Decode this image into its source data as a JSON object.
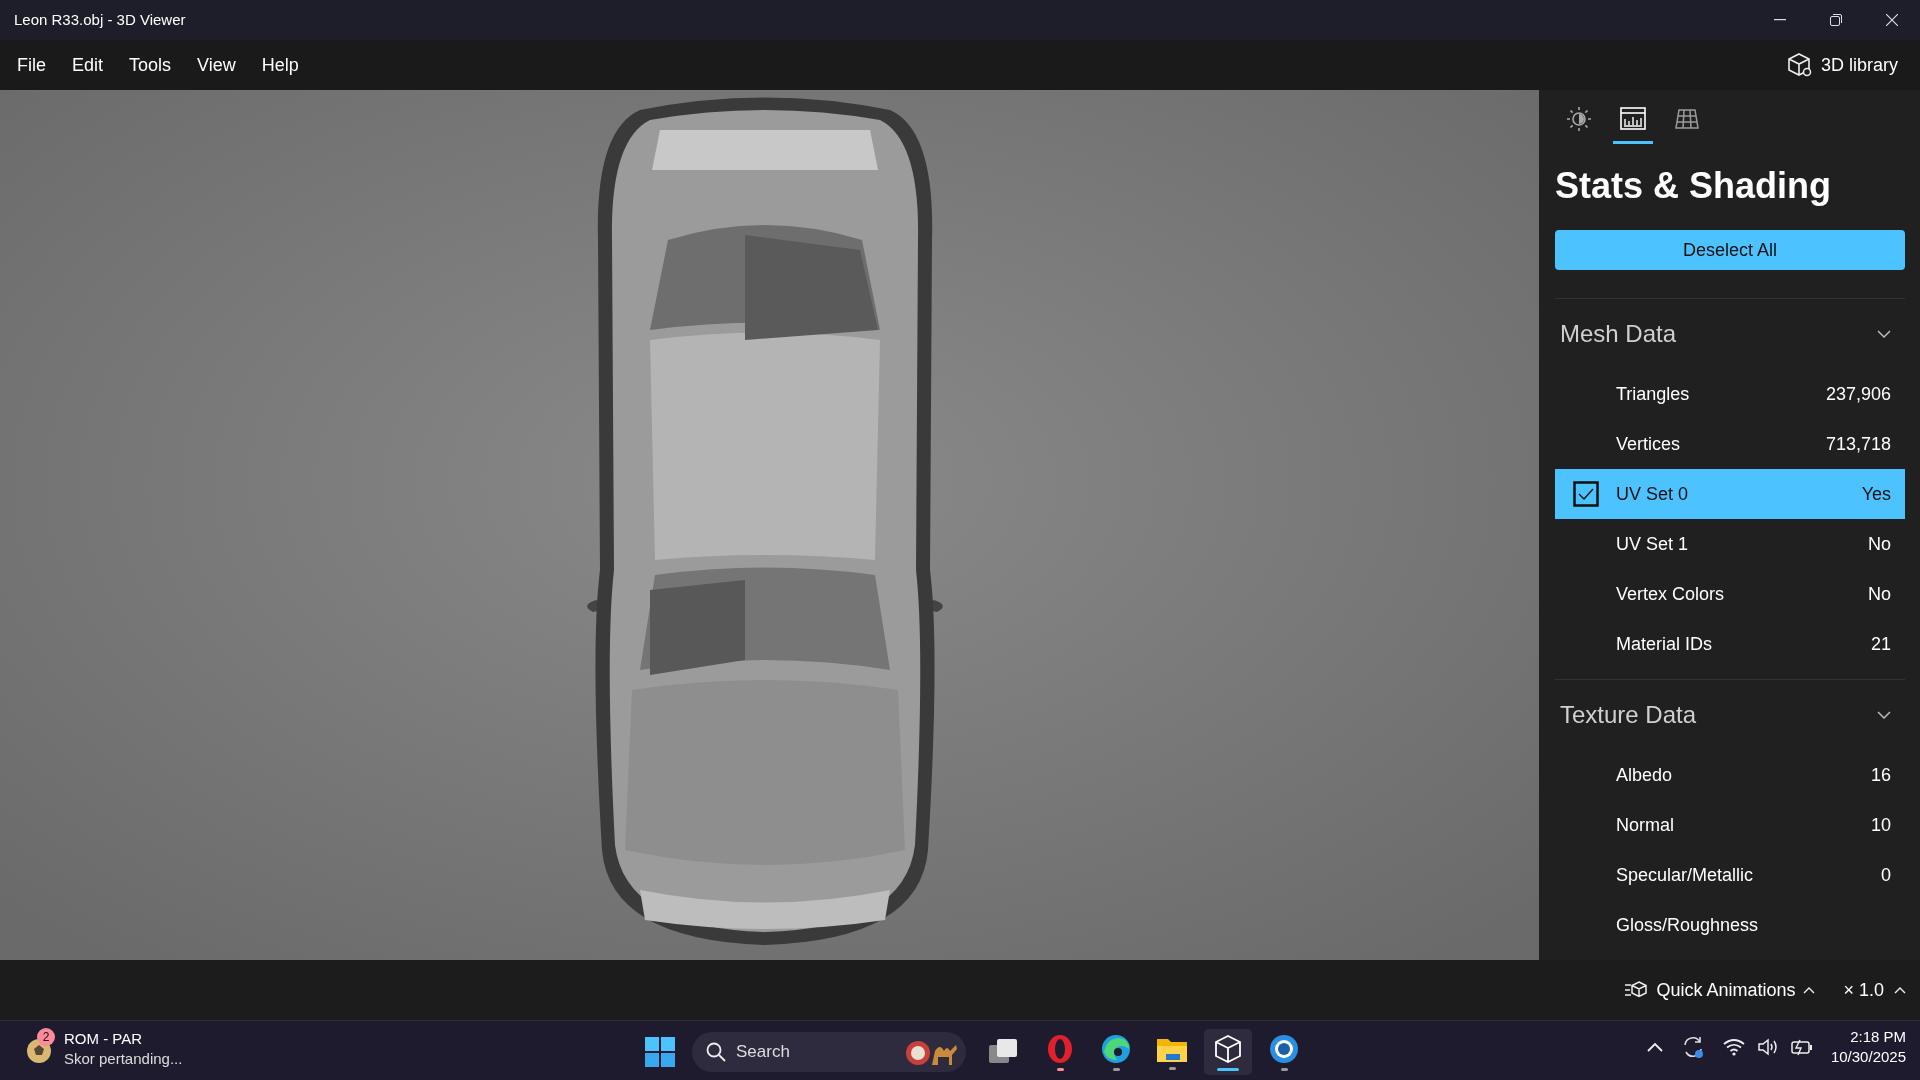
{
  "window": {
    "title": "Leon R33.obj - 3D Viewer"
  },
  "menu": [
    "File",
    "Edit",
    "Tools",
    "View",
    "Help"
  ],
  "library_button": {
    "label": "3D library"
  },
  "panel": {
    "tabs": [
      {
        "kind": "lighting",
        "selected": false
      },
      {
        "kind": "stats",
        "selected": true
      },
      {
        "kind": "grid",
        "selected": false
      }
    ],
    "title": "Stats & Shading",
    "deselect_button": "Deselect All",
    "sections": [
      {
        "title": "Mesh Data",
        "expanded": true,
        "rows": [
          {
            "label": "Triangles",
            "value": "237,906",
            "selected": false
          },
          {
            "label": "Vertices",
            "value": "713,718",
            "selected": false
          },
          {
            "label": "UV Set 0",
            "value": "Yes",
            "selected": true
          },
          {
            "label": "UV Set 1",
            "value": "No",
            "selected": false
          },
          {
            "label": "Vertex Colors",
            "value": "No",
            "selected": false
          },
          {
            "label": "Material IDs",
            "value": "21",
            "selected": false
          }
        ]
      },
      {
        "title": "Texture Data",
        "expanded": true,
        "rows": [
          {
            "label": "Albedo",
            "value": "16",
            "selected": false
          },
          {
            "label": "Normal",
            "value": "10",
            "selected": false
          },
          {
            "label": "Specular/Metallic",
            "value": "0",
            "selected": false
          },
          {
            "label": "Gloss/Roughness",
            "selected": false
          }
        ]
      }
    ]
  },
  "animation_bar": {
    "quick_animations": "Quick Animations",
    "speed": "× 1.0"
  },
  "taskbar": {
    "widget": {
      "badge": "2",
      "title": "ROM - PAR",
      "subtitle": "Skor pertanding..."
    },
    "search": {
      "placeholder": "Search"
    },
    "apps": [
      {
        "kind": "opera",
        "running": true,
        "selected": false,
        "color": "#ff8a9a"
      },
      {
        "kind": "edge",
        "running": true,
        "selected": false,
        "color": "#9a9a9a"
      },
      {
        "kind": "explorer",
        "running": true,
        "selected": false,
        "color": "#9a9a9a"
      },
      {
        "kind": "viewer",
        "running": true,
        "selected": true,
        "color": "#4cc2ff"
      },
      {
        "kind": "shutter",
        "running": true,
        "selected": false,
        "color": "#9a9a9a"
      }
    ],
    "time": "2:18 PM",
    "date": "10/30/2025"
  }
}
